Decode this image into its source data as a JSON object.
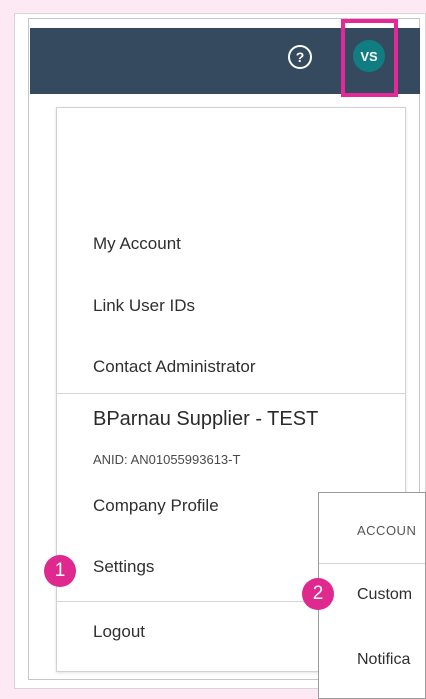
{
  "header": {
    "help_label": "?",
    "avatar_initials": "VS"
  },
  "menu": {
    "items": [
      {
        "label": "My Account"
      },
      {
        "label": "Link User IDs"
      },
      {
        "label": "Contact Administrator"
      }
    ],
    "company": {
      "name": "BParnau Supplier - TEST",
      "anid": "ANID: AN01055993613-T",
      "profile_label": "Company Profile"
    },
    "settings_label": "Settings",
    "logout_label": "Logout"
  },
  "submenu": {
    "header": "ACCOUN",
    "items": [
      {
        "label": "Custom"
      },
      {
        "label": "Notifica"
      }
    ]
  },
  "annotations": {
    "step1": "1",
    "step2": "2"
  },
  "colors": {
    "topbar": "#354a5f",
    "avatar": "#0f7d82",
    "highlight": "#e6279a",
    "badge": "#e0298e"
  }
}
